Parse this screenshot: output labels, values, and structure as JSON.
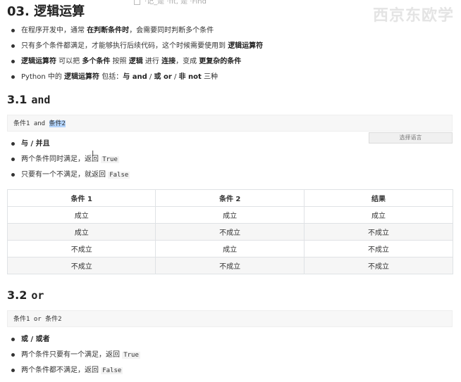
{
  "top_fragment": "·记_是 ·fit, 是 ·Find",
  "watermark": "西京东欧学",
  "title": "03. 逻辑运算",
  "intro": [
    [
      {
        "t": "在程序开发中，通常 "
      },
      {
        "t": "在判断条件时",
        "b": true
      },
      {
        "t": "，会需要同时判断多个条件"
      }
    ],
    [
      {
        "t": "只有多个条件都满足，才能够执行后续代码，这个时候需要使用到 "
      },
      {
        "t": "逻辑运算符",
        "b": true
      }
    ],
    [
      {
        "t": "逻辑运算符",
        "b": true
      },
      {
        "t": " 可以把 "
      },
      {
        "t": "多个条件",
        "b": true
      },
      {
        "t": " 按照 "
      },
      {
        "t": "逻辑",
        "b": true
      },
      {
        "t": " 进行 "
      },
      {
        "t": "连接",
        "b": true
      },
      {
        "t": "，变成 "
      },
      {
        "t": "更复杂的条件",
        "b": true
      }
    ],
    [
      {
        "t": "Python 中的 "
      },
      {
        "t": "逻辑运算符",
        "b": true
      },
      {
        "t": " 包括："
      },
      {
        "t": "与 and",
        "b": true
      },
      {
        "t": " / "
      },
      {
        "t": "或 or",
        "b": true
      },
      {
        "t": " / "
      },
      {
        "t": "非 not",
        "b": true
      },
      {
        "t": " 三种"
      }
    ]
  ],
  "and_section": {
    "number": "3.1",
    "keyword": "and",
    "code_prefix": "条件1 and ",
    "code_selected": "条件2",
    "lang_button": "选择语言",
    "cursor_glyph": "I",
    "bullets": [
      [
        {
          "t": "与 / 并且",
          "b": true
        }
      ],
      [
        {
          "t": "两个条件同时满足，返回 "
        },
        {
          "t": "True",
          "c": true
        }
      ],
      [
        {
          "t": "只要有一个不满足，就返回 "
        },
        {
          "t": "False",
          "c": true
        }
      ]
    ],
    "table": {
      "headers": [
        "条件 1",
        "条件 2",
        "结果"
      ],
      "rows": [
        [
          "成立",
          "成立",
          "成立"
        ],
        [
          "成立",
          "不成立",
          "不成立"
        ],
        [
          "不成立",
          "成立",
          "不成立"
        ],
        [
          "不成立",
          "不成立",
          "不成立"
        ]
      ]
    }
  },
  "or_section": {
    "number": "3.2",
    "keyword": "or",
    "code": "条件1 or 条件2",
    "bullets": [
      [
        {
          "t": "或 / 或者",
          "b": true
        }
      ],
      [
        {
          "t": "两个条件只要有一个满足，返回 "
        },
        {
          "t": "True",
          "c": true
        }
      ],
      [
        {
          "t": "两个条件都不满足，返回 "
        },
        {
          "t": "False",
          "c": true
        }
      ]
    ]
  }
}
